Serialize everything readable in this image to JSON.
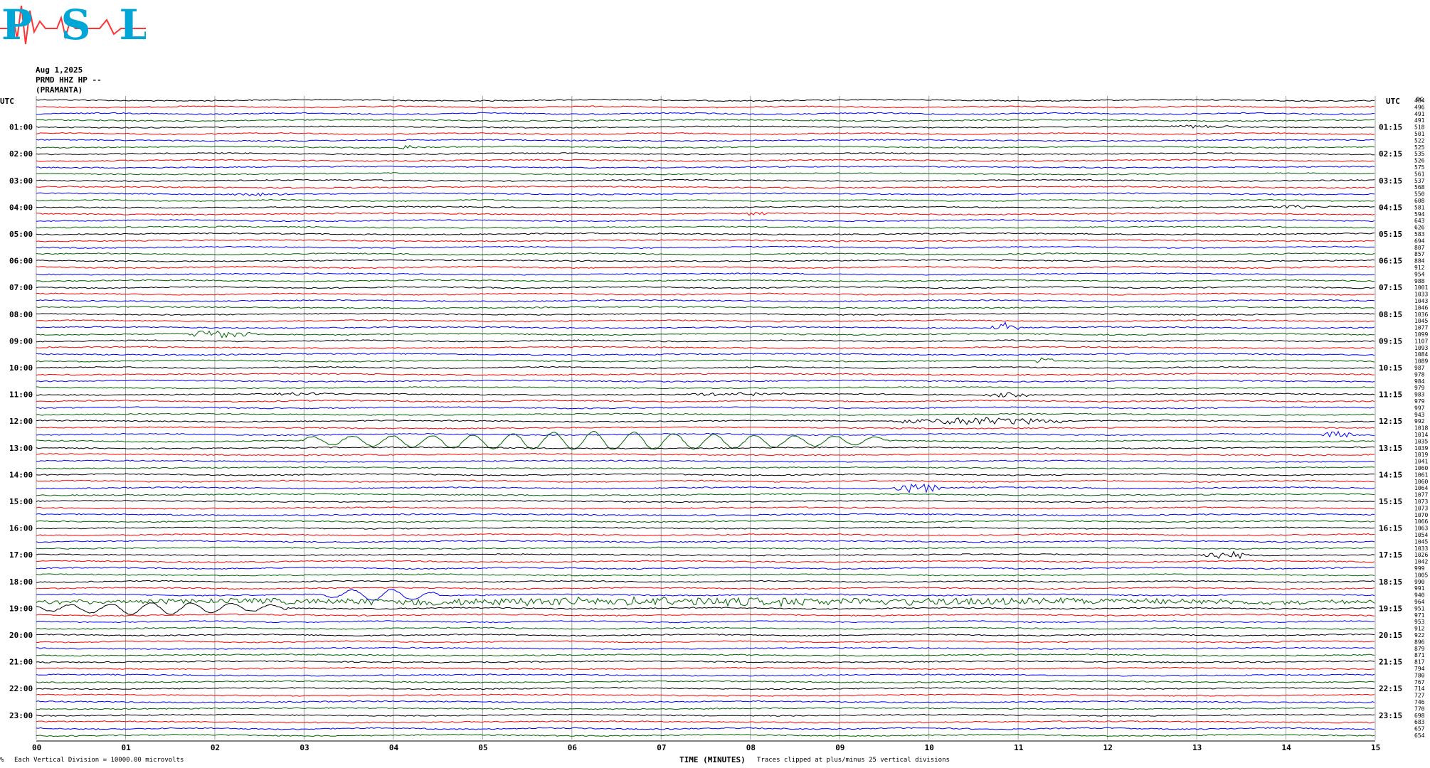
{
  "logo": {
    "text": "PSL"
  },
  "header": {
    "date": "Aug 1,2025",
    "station": "PRMD HHZ HP --",
    "location": "(PRAMANTA)"
  },
  "left_axis_title": "UTC",
  "right_axis_title": "UTC",
  "dc_title": "DC",
  "footer": {
    "scale_note": "Each Vertical Division = 10000.00 microvolts",
    "xlabel": "TIME (MINUTES)",
    "clip_note": "Traces clipped at plus/minus 25 vertical divisions",
    "corner_mark": "%"
  },
  "colors": {
    "black": "#000000",
    "red": "#ff0000",
    "blue": "#0000ff",
    "green": "#006400",
    "grid": "#a0a0a0"
  },
  "chart_data": {
    "type": "line",
    "xlabel": "TIME (MINUTES)",
    "x_ticks": [
      "00",
      "01",
      "02",
      "03",
      "04",
      "05",
      "06",
      "07",
      "08",
      "09",
      "10",
      "11",
      "12",
      "13",
      "14",
      "15"
    ],
    "xlim": [
      0,
      15
    ],
    "row_color_cycle": [
      "black",
      "red",
      "blue",
      "green"
    ],
    "rows_per_hour": 4,
    "left_labels": [
      "01:00",
      "02:00",
      "03:00",
      "04:00",
      "05:00",
      "06:00",
      "07:00",
      "08:00",
      "09:00",
      "10:00",
      "11:00",
      "12:00",
      "13:00",
      "14:00",
      "15:00",
      "16:00",
      "17:00",
      "18:00",
      "19:00",
      "20:00",
      "21:00",
      "22:00",
      "23:00"
    ],
    "right_labels": [
      "01:15",
      "02:15",
      "03:15",
      "04:15",
      "05:15",
      "06:15",
      "07:15",
      "08:15",
      "09:15",
      "10:15",
      "11:15",
      "12:15",
      "13:15",
      "14:15",
      "15:15",
      "16:15",
      "17:15",
      "18:15",
      "19:15",
      "20:15",
      "21:15",
      "22:15",
      "23:15"
    ],
    "dc_offsets": [
      "484",
      "496",
      "491",
      "491",
      "518",
      "501",
      "522",
      "525",
      "535",
      "526",
      "575",
      "561",
      "537",
      "568",
      "550",
      "608",
      "581",
      "594",
      "643",
      "626",
      "583",
      "694",
      "807",
      "857",
      "884",
      "912",
      "954",
      "988",
      "1001",
      "1033",
      "1043",
      "1046",
      "1036",
      "1045",
      "1077",
      "1099",
      "1107",
      "1093",
      "1084",
      "1089",
      "987",
      "978",
      "984",
      "979",
      "983",
      "979",
      "997",
      "943",
      "992",
      "1018",
      "1014",
      "1035",
      "1039",
      "1019",
      "1041",
      "1060",
      "1061",
      "1060",
      "1064",
      "1077",
      "1073",
      "1073",
      "1070",
      "1066",
      "1063",
      "1054",
      "1045",
      "1033",
      "1026",
      "1042",
      "999",
      "1005",
      "990",
      "991",
      "940",
      "964",
      "951",
      "971",
      "953",
      "912",
      "922",
      "896",
      "879",
      "871",
      "817",
      "794",
      "780",
      "767",
      "714",
      "727",
      "746",
      "770",
      "698",
      "683",
      "657",
      "654"
    ],
    "events": [
      {
        "row": 4,
        "start_min": 12.7,
        "end_min": 13.5,
        "amp": 2
      },
      {
        "row": 7,
        "start_min": 4.0,
        "end_min": 4.3,
        "amp": 3
      },
      {
        "row": 14,
        "start_min": 2.2,
        "end_min": 2.8,
        "amp": 2
      },
      {
        "row": 16,
        "start_min": 13.8,
        "end_min": 14.3,
        "amp": 3
      },
      {
        "row": 17,
        "start_min": 7.9,
        "end_min": 8.2,
        "amp": 3
      },
      {
        "row": 35,
        "start_min": 1.7,
        "end_min": 2.4,
        "amp": 6
      },
      {
        "row": 34,
        "start_min": 10.7,
        "end_min": 11.0,
        "amp": 8
      },
      {
        "row": 39,
        "start_min": 11.2,
        "end_min": 11.4,
        "amp": 5
      },
      {
        "row": 44,
        "start_min": 2.6,
        "end_min": 3.3,
        "amp": 2
      },
      {
        "row": 44,
        "start_min": 7.3,
        "end_min": 8.5,
        "amp": 3
      },
      {
        "row": 44,
        "start_min": 10.6,
        "end_min": 11.2,
        "amp": 3
      },
      {
        "row": 48,
        "start_min": 9.7,
        "end_min": 11.5,
        "amp": 6
      },
      {
        "row": 50,
        "start_min": 14.4,
        "end_min": 14.8,
        "amp": 6
      },
      {
        "row": 51,
        "start_min": 3.0,
        "end_min": 9.5,
        "amp": 13
      },
      {
        "row": 58,
        "start_min": 9.6,
        "end_min": 10.2,
        "amp": 7
      },
      {
        "row": 68,
        "start_min": 13.0,
        "end_min": 13.6,
        "amp": 6
      },
      {
        "row": 74,
        "start_min": 3.2,
        "end_min": 4.5,
        "amp": 9
      },
      {
        "row": 75,
        "start_min": 0.0,
        "end_min": 15.0,
        "amp": 6
      },
      {
        "row": 76,
        "start_min": 0.0,
        "end_min": 2.8,
        "amp": 9
      }
    ]
  }
}
